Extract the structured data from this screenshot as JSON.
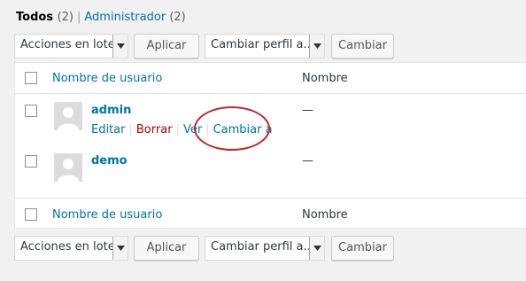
{
  "views": {
    "all_label": "Todos",
    "all_count": "(2)",
    "separator": "|",
    "admin_label": "Administrador",
    "admin_count": "(2)"
  },
  "top_nav": {
    "bulk_actions": "Acciones en lote",
    "apply": "Aplicar",
    "change_role": "Cambiar perfil a...",
    "change": "Cambiar"
  },
  "bottom_nav": {
    "bulk_actions": "Acciones en lote",
    "apply": "Aplicar",
    "change_role": "Cambiar perfil a...",
    "change": "Cambiar"
  },
  "table": {
    "headers": {
      "username": "Nombre de usuario",
      "name": "Nombre"
    },
    "footers": {
      "username": "Nombre de usuario",
      "name": "Nombre"
    },
    "rows": [
      {
        "username": "admin",
        "name": "—",
        "actions": {
          "edit": "Editar",
          "delete": "Borrar",
          "view": "Ver",
          "switch": "Cambiar a"
        }
      },
      {
        "username": "demo",
        "name": "—"
      }
    ],
    "action_separator": "|"
  },
  "colors": {
    "link": "#0073aa",
    "delete": "#a00",
    "highlight_ring": "#c0272d"
  },
  "icons": {
    "dropdown": "chevron-down-icon",
    "avatar": "avatar-placeholder-icon"
  }
}
